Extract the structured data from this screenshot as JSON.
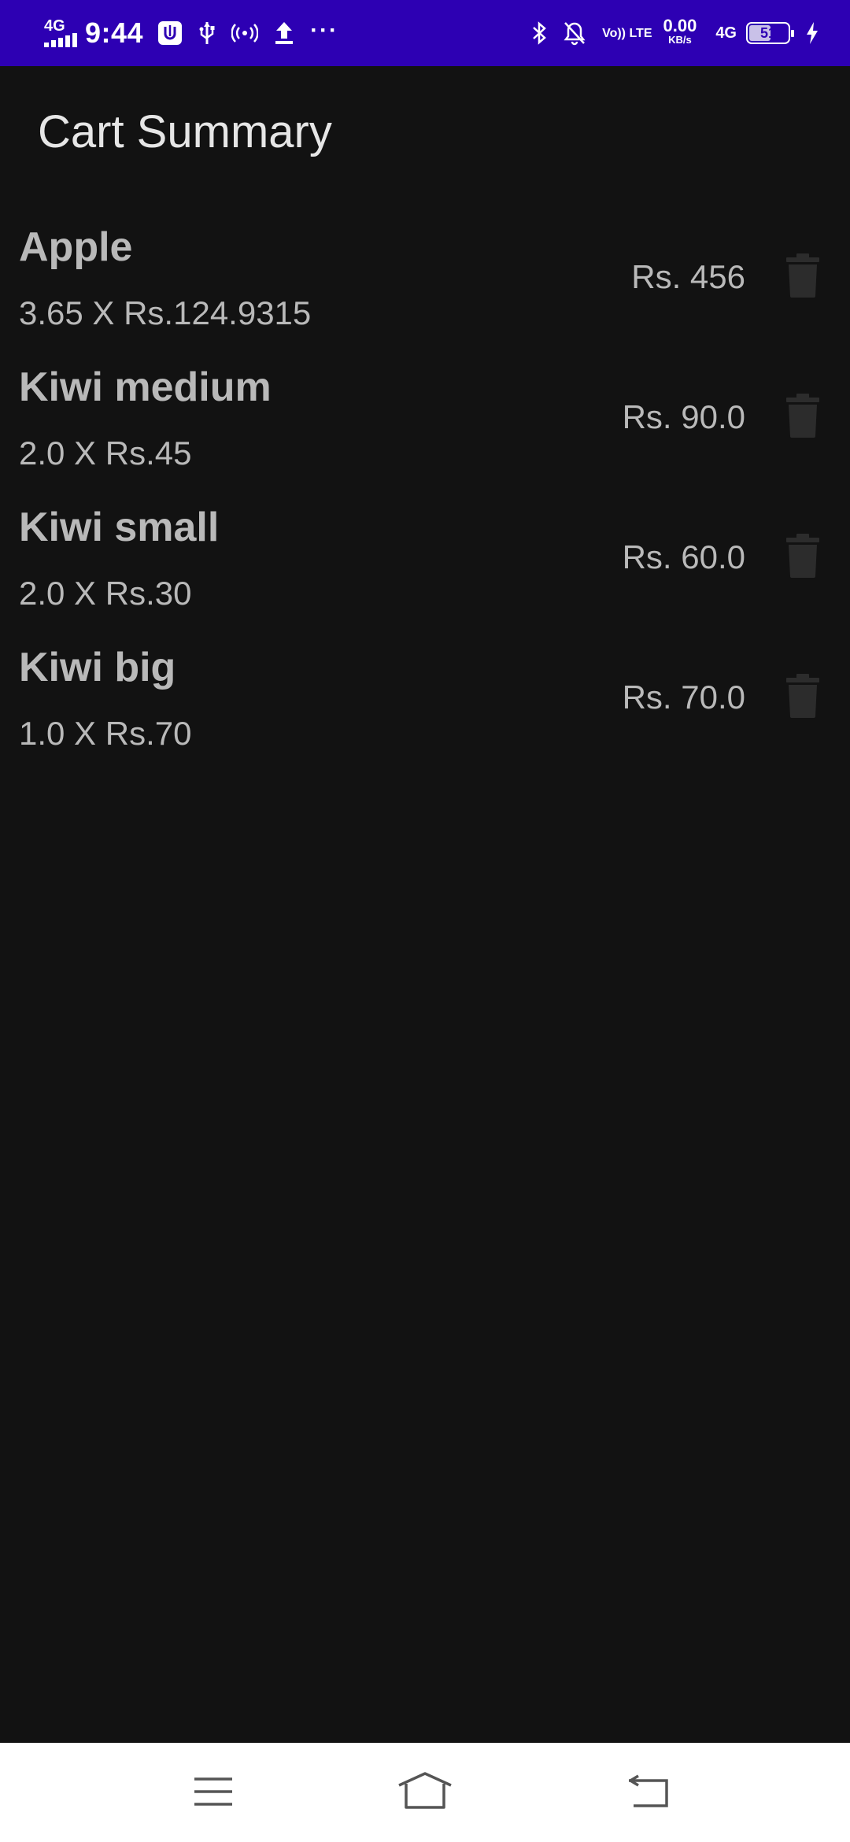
{
  "status_bar": {
    "network_type": "4G",
    "time": "9:44",
    "volte": "Vo)) LTE",
    "speed_value": "0.00",
    "speed_unit": "KB/s",
    "network_type_right": "4G",
    "battery_level": "51",
    "colors": {
      "background": "#2d00b3",
      "text": "#ffffff"
    }
  },
  "header": {
    "title": "Cart Summary"
  },
  "cart": {
    "items": [
      {
        "name": "Apple",
        "quantity_price": "3.65 X Rs.124.9315",
        "total": "Rs. 456"
      },
      {
        "name": "Kiwi medium",
        "quantity_price": "2.0 X Rs.45",
        "total": "Rs. 90.0"
      },
      {
        "name": "Kiwi small",
        "quantity_price": "2.0 X Rs.30",
        "total": "Rs. 60.0"
      },
      {
        "name": "Kiwi big",
        "quantity_price": "1.0 X Rs.70",
        "total": "Rs. 70.0"
      }
    ],
    "delete_icon": "trash-icon"
  },
  "nav_bar": {
    "buttons": [
      "menu-icon",
      "home-icon",
      "back-icon"
    ]
  },
  "theme": {
    "background": "#121212",
    "text_primary": "#b9b9b9",
    "title_text": "#e6e6e6"
  }
}
